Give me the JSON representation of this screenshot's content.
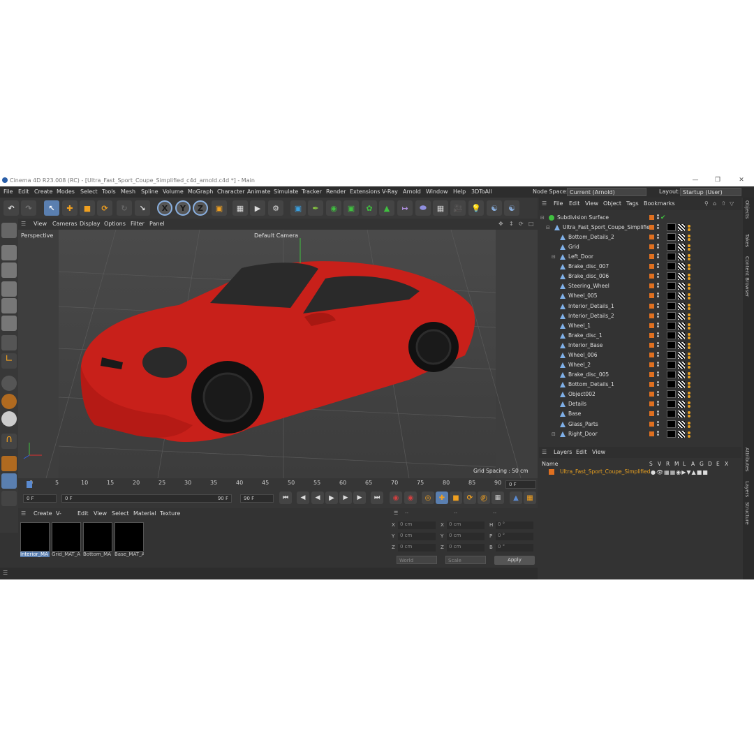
{
  "window": {
    "title": "Cinema 4D R23.008 (RC) - [Ultra_Fast_Sport_Coupe_Simplified_c4d_arnold.c4d *] - Main"
  },
  "menu": [
    "File",
    "Edit",
    "Create",
    "Modes",
    "Select",
    "Tools",
    "Mesh",
    "Spline",
    "Volume",
    "MoGraph",
    "Character",
    "Animate",
    "Simulate",
    "Tracker",
    "Render",
    "Extensions",
    "V-Ray",
    "Arnold",
    "Window",
    "Help",
    "3DToAll"
  ],
  "node_space": {
    "label": "Node Space:",
    "value": "Current (Arnold)"
  },
  "layout": {
    "label": "Layout:",
    "value": "Startup (User)"
  },
  "axis_buttons": [
    "X",
    "Y",
    "Z"
  ],
  "viewport": {
    "menu": [
      "View",
      "Cameras",
      "Display",
      "Options",
      "Filter",
      "Panel"
    ],
    "name": "Perspective",
    "camera": "Default Camera",
    "grid_spacing": "Grid Spacing : 50 cm",
    "car_color": "#c8201a"
  },
  "timeline": {
    "ticks": [
      "0",
      "5",
      "10",
      "15",
      "20",
      "25",
      "30",
      "35",
      "40",
      "45",
      "50",
      "55",
      "60",
      "65",
      "70",
      "75",
      "80",
      "85",
      "90"
    ],
    "current_frame": "0 F",
    "start": "0 F",
    "range_start": "0 F",
    "range_end": "90 F",
    "end": "90 F"
  },
  "material_panel": {
    "menu": [
      "Create",
      "V-Ray",
      "Edit",
      "View",
      "Select",
      "Material",
      "Texture"
    ],
    "materials": [
      "Interior_MA",
      "Grid_MAT_A",
      "Bottom_MA",
      "Base_MAT_A"
    ]
  },
  "coordinates": {
    "header": [
      "--",
      "--",
      "--"
    ],
    "rows": [
      {
        "a": "X",
        "av": "0 cm",
        "b": "X",
        "bv": "0 cm",
        "c": "H",
        "cv": "0 °"
      },
      {
        "a": "Y",
        "av": "0 cm",
        "b": "Y",
        "bv": "0 cm",
        "c": "P",
        "cv": "0 °"
      },
      {
        "a": "Z",
        "av": "0 cm",
        "b": "Z",
        "bv": "0 cm",
        "c": "B",
        "cv": "0 °"
      }
    ],
    "world": "World",
    "scale": "Scale",
    "apply": "Apply"
  },
  "objects_panel": {
    "menu": [
      "File",
      "Edit",
      "View",
      "Object",
      "Tags",
      "Bookmarks"
    ],
    "root": "Subdivision Surface",
    "group": "Ultra_Fast_Sport_Coupe_Simplified",
    "items": [
      "Bottom_Details_2",
      "Grid",
      "Left_Door",
      "Brake_disc_007",
      "Brake_disc_006",
      "Steering_Wheel",
      "Wheel_005",
      "Interior_Details_1",
      "Interior_Details_2",
      "Wheel_1",
      "Brake_disc_1",
      "Interior_Base",
      "Wheel_006",
      "Wheel_2",
      "Brake_disc_005",
      "Bottom_Details_1",
      "Object002",
      "Details",
      "Base",
      "Glass_Parts",
      "Right_Door"
    ]
  },
  "layers_panel": {
    "menu": [
      "Layers",
      "Edit",
      "View"
    ],
    "name_header": "Name",
    "columns": [
      "S",
      "V",
      "R",
      "M",
      "L",
      "A",
      "G",
      "D",
      "E",
      "X"
    ],
    "layer": "Ultra_Fast_Sport_Coupe_Simplified"
  },
  "side_tabs": [
    "Objects",
    "Takes",
    "Content Browser",
    "Attributes",
    "Layers",
    "Structure"
  ]
}
